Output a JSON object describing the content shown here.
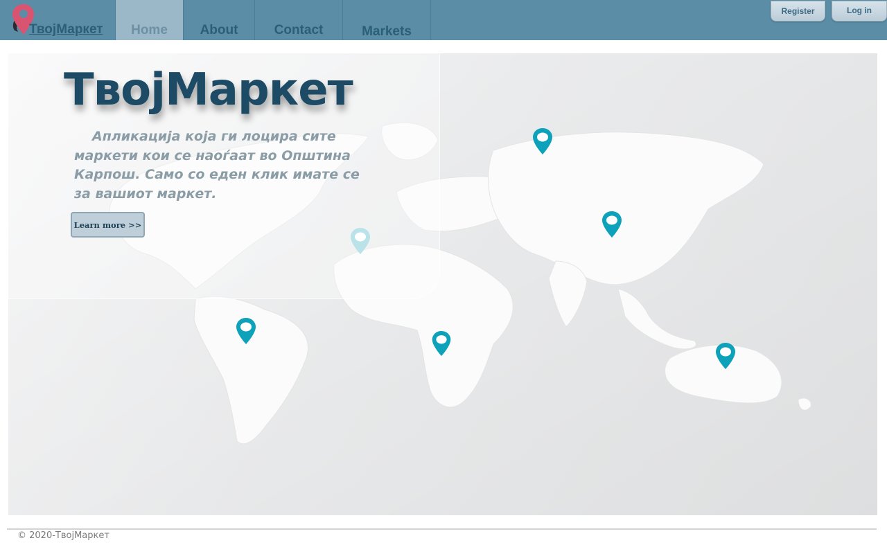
{
  "navbar": {
    "brand": {
      "text": "ТвојМаркет",
      "logo_icon": "map-pin-logo-icon"
    },
    "items": [
      {
        "label": "Home",
        "active": true
      },
      {
        "label": "About",
        "active": false
      },
      {
        "label": "Contact",
        "active": false
      },
      {
        "label": "Markets",
        "active": false
      }
    ],
    "register_label": "Register",
    "login_label": "Log in"
  },
  "hero": {
    "title": "ТвојМаркет",
    "description": "Апликација која ги лоцира сите маркети кои се наоѓаат во Општина Карпош. Само со еден клик имате се за вашиот маркет.",
    "learn_more_label": "Learn more >>",
    "pin_icon": "map-pin-icon"
  },
  "footer": {
    "text": "© 2020-ТвојМаркет"
  },
  "colors": {
    "navbar_bg": "#5b8ea6",
    "nav_text": "#2b5e78",
    "active_tab_bg": "#9ab8c8",
    "title": "#1d4a64",
    "description": "#8a9ca6",
    "pin": "#0ea2ba",
    "pin_faded": "#b9e2e9",
    "logo_pin": "#d95470"
  }
}
